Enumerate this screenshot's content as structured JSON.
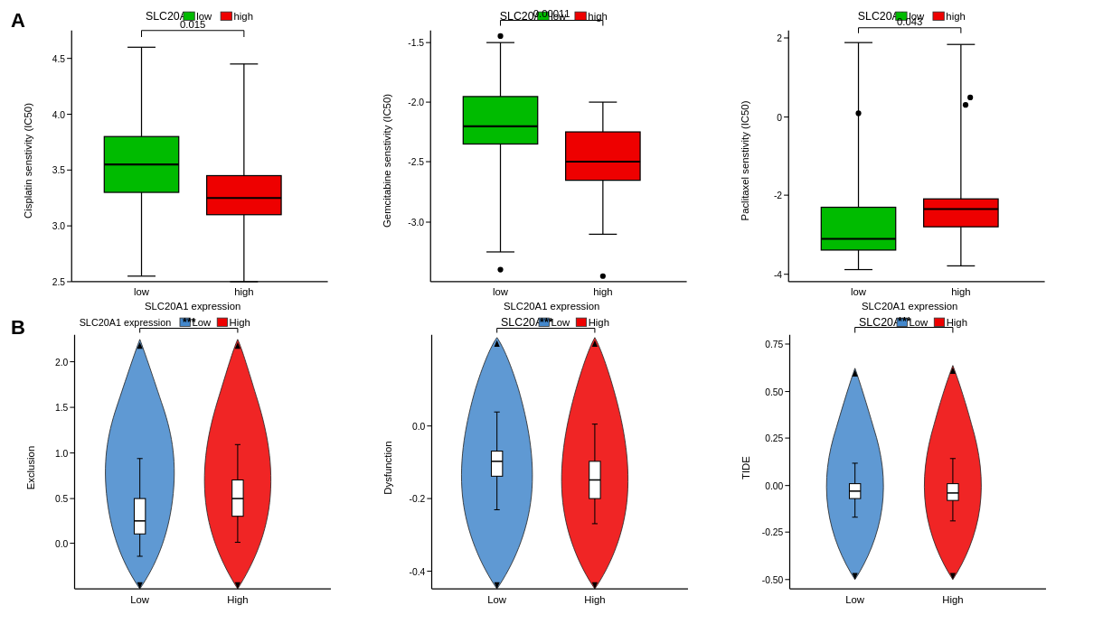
{
  "section_a": {
    "label": "A",
    "panels": [
      {
        "id": "cisplatin",
        "title": "SLC20A1",
        "legend_low": "low",
        "legend_high": "high",
        "x_label": "SLC20A1 expression",
        "y_label": "Cisplatin senstivity (IC50)",
        "pval": "0.015",
        "groups": [
          {
            "name": "low",
            "color": "#00bb00",
            "q1": 3.3,
            "median": 3.55,
            "q3": 3.8,
            "min": 2.55,
            "max": 4.6,
            "outliers": []
          },
          {
            "name": "high",
            "color": "#ee0000",
            "q1": 3.1,
            "median": 3.25,
            "q3": 3.45,
            "min": 2.5,
            "max": 4.45,
            "outliers": []
          }
        ],
        "ymin": 2.5,
        "ymax": 4.75,
        "yticks": [
          2.5,
          3.0,
          3.5,
          4.0,
          4.5
        ]
      },
      {
        "id": "gemcitabine",
        "title": "SLC20A1",
        "legend_low": "low",
        "legend_high": "high",
        "x_label": "SLC20A1 expression",
        "y_label": "Gemcitabine senstivity (IC50)",
        "pval": "0.00011",
        "groups": [
          {
            "name": "low",
            "color": "#00bb00",
            "q1": -2.35,
            "median": -2.2,
            "q3": -1.95,
            "min": -3.25,
            "max": -1.5,
            "outliers": [
              -3.4,
              -1.45
            ]
          },
          {
            "name": "high",
            "color": "#ee0000",
            "q1": -2.65,
            "median": -2.5,
            "q3": -2.25,
            "min": -3.1,
            "max": -2.0,
            "outliers": [
              -3.45
            ]
          }
        ],
        "ymin": -3.5,
        "ymax": -1.4,
        "yticks": [
          -3.0,
          -2.5,
          -2.0,
          -1.5
        ]
      },
      {
        "id": "paclitaxel",
        "title": "SLC20A1",
        "legend_low": "low",
        "legend_high": "high",
        "x_label": "SLC20A1 expression",
        "y_label": "Paclitaxel senstivity (IC50)",
        "pval": "0.043",
        "groups": [
          {
            "name": "low",
            "color": "#00bb00",
            "q1": -3.4,
            "median": -3.1,
            "q3": -2.3,
            "min": -3.9,
            "max": 1.9,
            "outliers": [
              0.1
            ]
          },
          {
            "name": "high",
            "color": "#ee0000",
            "q1": -2.8,
            "median": -2.35,
            "q3": -2.1,
            "min": -3.8,
            "max": 1.85,
            "outliers": [
              0.3,
              0.5
            ]
          }
        ],
        "ymin": -4.2,
        "ymax": 2.2,
        "yticks": [
          -4,
          -2,
          0,
          2
        ]
      }
    ]
  },
  "section_b": {
    "label": "B",
    "panels": [
      {
        "id": "exclusion",
        "title": "SLC20A1 expression",
        "legend_low": "Low",
        "legend_high": "High",
        "x_label": "",
        "y_label": "Exclusion",
        "pval": "***",
        "groups": [
          {
            "name": "Low",
            "color": "#4488cc"
          },
          {
            "name": "High",
            "color": "#ee0000"
          }
        ],
        "ymin": -0.5,
        "ymax": 2.3,
        "yticks": [
          0.0,
          0.5,
          1.0,
          1.5,
          2.0
        ]
      },
      {
        "id": "dysfunction",
        "title": "SLC20A1",
        "legend_low": "Low",
        "legend_high": "High",
        "x_label": "",
        "y_label": "Dysfunction",
        "pval": "***",
        "groups": [
          {
            "name": "Low",
            "color": "#4488cc"
          },
          {
            "name": "High",
            "color": "#ee0000"
          }
        ],
        "ymin": -0.45,
        "ymax": 0.25,
        "yticks": [
          -0.4,
          -0.2,
          0.0
        ]
      },
      {
        "id": "tide",
        "title": "SLC20A1",
        "legend_low": "Low",
        "legend_high": "High",
        "x_label": "",
        "y_label": "TIDE",
        "pval": "***",
        "groups": [
          {
            "name": "Low",
            "color": "#4488cc"
          },
          {
            "name": "High",
            "color": "#ee0000"
          }
        ],
        "ymin": -0.55,
        "ymax": 0.8,
        "yticks": [
          -0.5,
          -0.25,
          0.0,
          0.25,
          0.5,
          0.75
        ]
      }
    ]
  }
}
